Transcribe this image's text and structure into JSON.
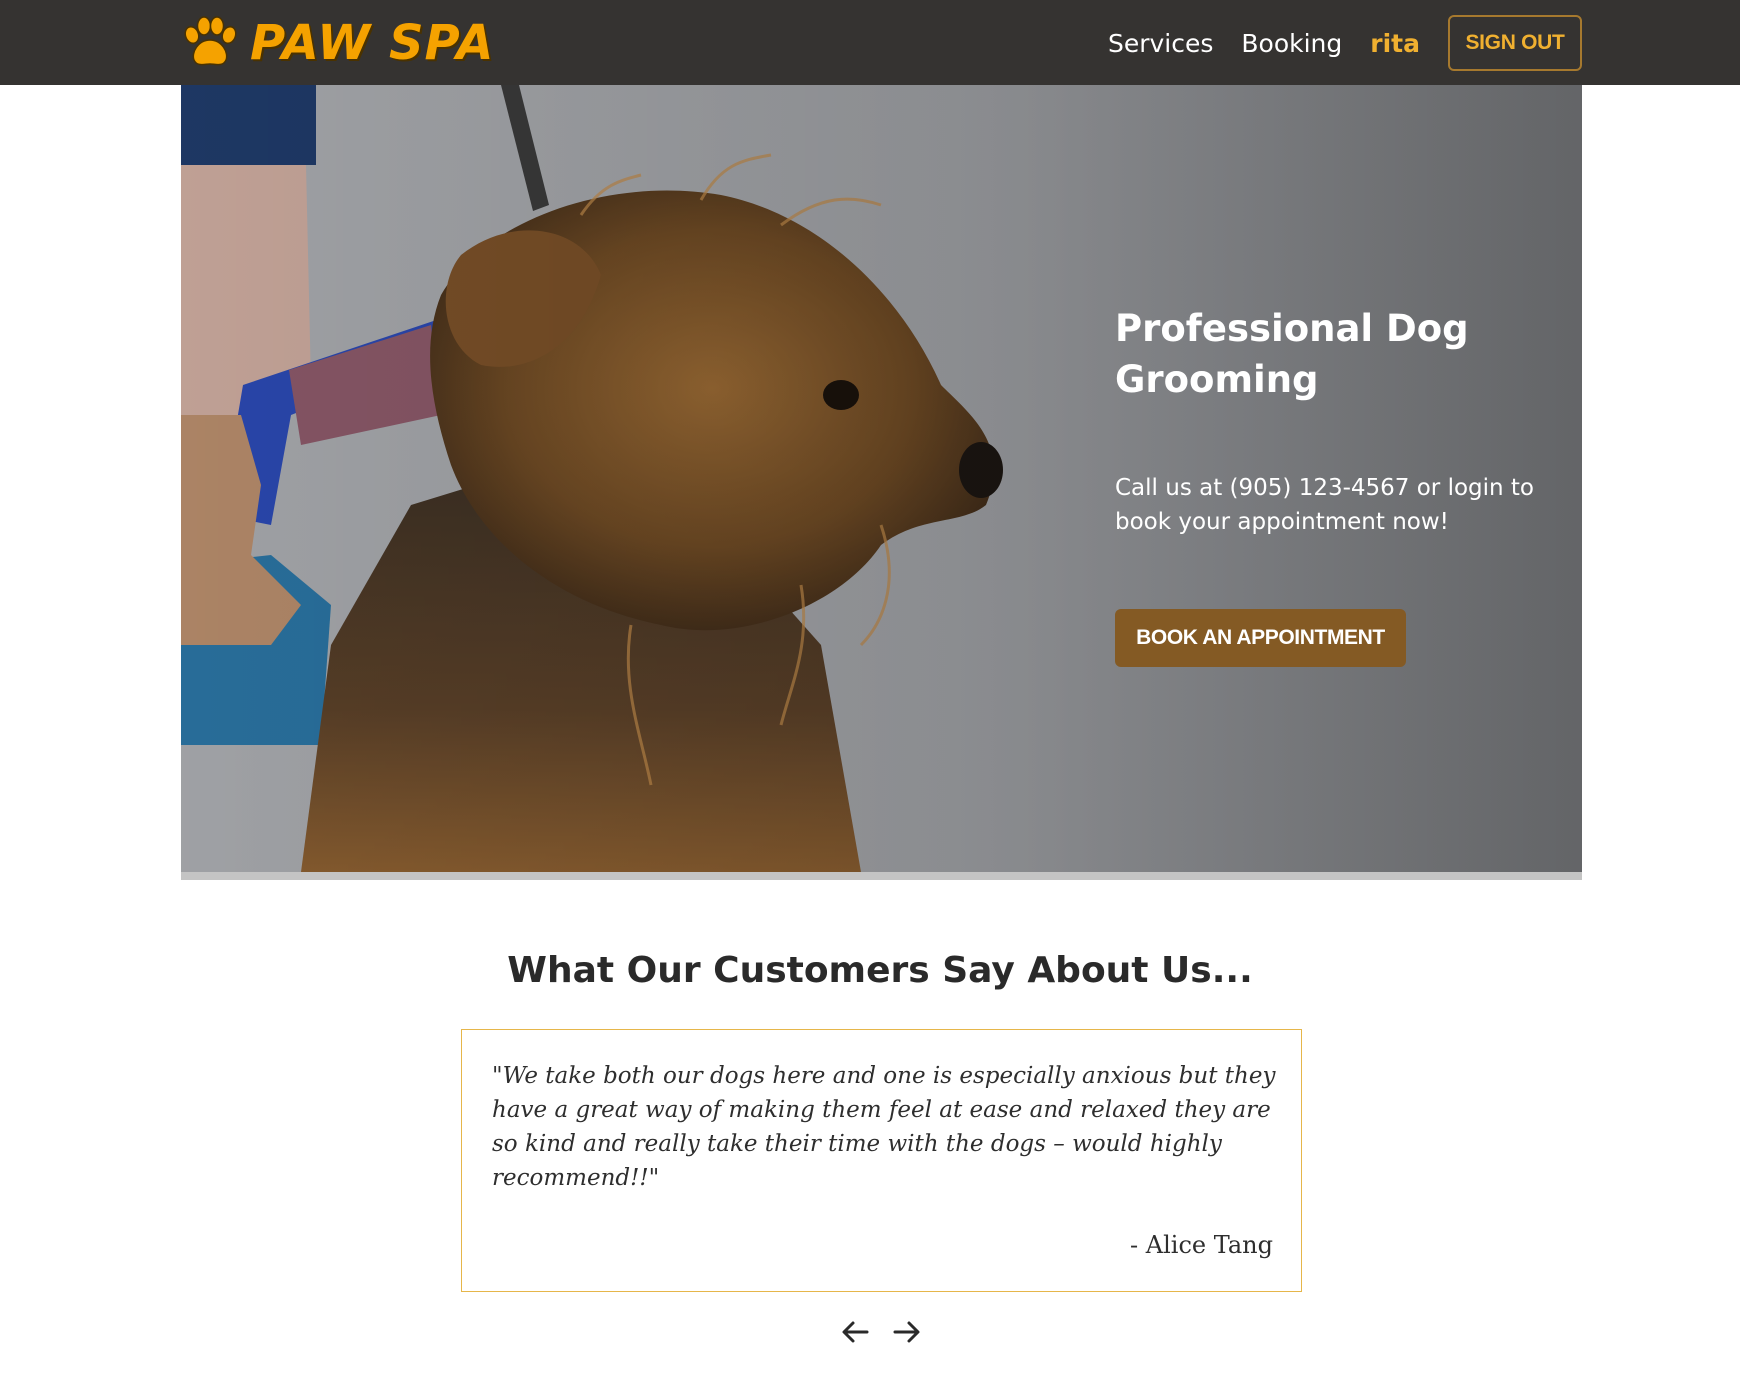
{
  "navbar": {
    "brand": "PAW SPA",
    "links": {
      "services": "Services",
      "booking": "Booking"
    },
    "user_name": "rita",
    "sign_out_label": "SIGN OUT"
  },
  "hero": {
    "title": "Professional Dog Grooming",
    "text": "Call us at (905) 123-4567 or login to book your appointment now!",
    "cta_label": "BOOK AN APPOINTMENT"
  },
  "testimonials": {
    "title": "What Our Customers Say About Us...",
    "quote": "\"We take both our dogs here and one is especially anxious but they have a great way of making them feel at ease and relaxed they are so kind and really take their time with the dogs – would highly recommend!!\"",
    "author": "- Alice Tang"
  },
  "colors": {
    "navbar_bg": "#353331",
    "brand_orange": "#f5a200",
    "user_gold": "#f0b030",
    "button_brown": "#845a24",
    "card_border": "#e6b64a"
  },
  "icons": {
    "brand": "paw-icon",
    "prev": "arrow-left-icon",
    "next": "arrow-right-icon"
  }
}
